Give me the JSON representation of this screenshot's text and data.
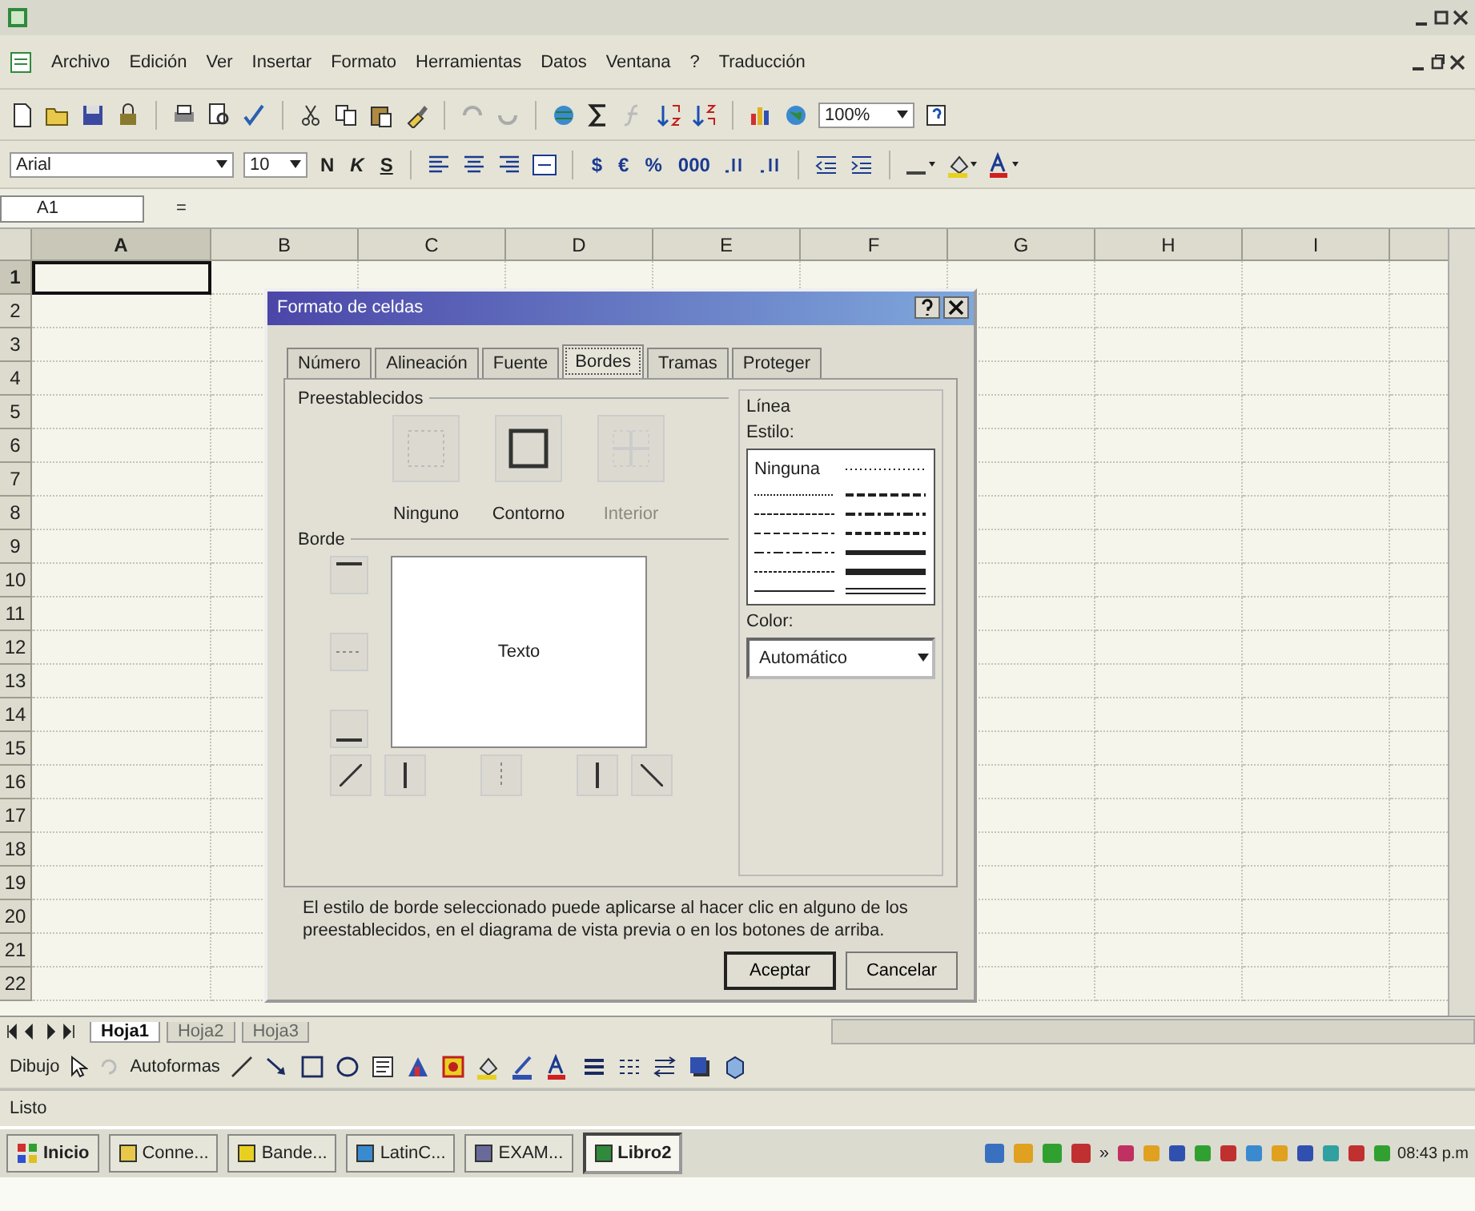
{
  "menu_bar": [
    "Archivo",
    "Edición",
    "Ver",
    "Insertar",
    "Formato",
    "Herramientas",
    "Datos",
    "Ventana",
    "?",
    "Traducción"
  ],
  "standard_toolbar": {
    "zoom": "100%"
  },
  "formatting_toolbar": {
    "font": "Arial",
    "size": "10",
    "style_buttons": [
      "N",
      "K",
      "S"
    ],
    "number_buttons": [
      "$",
      "€",
      "%",
      "000"
    ]
  },
  "formula_bar": {
    "name_box": "A1",
    "value": "="
  },
  "sheet": {
    "columns": [
      {
        "label": "A",
        "selected": true
      },
      {
        "label": "B",
        "selected": false
      },
      {
        "label": "C",
        "selected": false
      },
      {
        "label": "D",
        "selected": false
      },
      {
        "label": "E",
        "selected": false
      },
      {
        "label": "F",
        "selected": false
      },
      {
        "label": "G",
        "selected": false
      },
      {
        "label": "H",
        "selected": false
      },
      {
        "label": "I",
        "selected": false
      }
    ],
    "rows": [
      {
        "label": "1",
        "selected": true
      },
      {
        "label": "2",
        "selected": false
      },
      {
        "label": "3",
        "selected": false
      },
      {
        "label": "4",
        "selected": false
      },
      {
        "label": "5",
        "selected": false
      },
      {
        "label": "6",
        "selected": false
      },
      {
        "label": "7",
        "selected": false
      },
      {
        "label": "8",
        "selected": false
      },
      {
        "label": "9",
        "selected": false
      },
      {
        "label": "10",
        "selected": false
      },
      {
        "label": "11",
        "selected": false
      },
      {
        "label": "12",
        "selected": false
      },
      {
        "label": "13",
        "selected": false
      },
      {
        "label": "14",
        "selected": false
      },
      {
        "label": "15",
        "selected": false
      },
      {
        "label": "16",
        "selected": false
      },
      {
        "label": "17",
        "selected": false
      },
      {
        "label": "18",
        "selected": false
      },
      {
        "label": "19",
        "selected": false
      },
      {
        "label": "20",
        "selected": false
      },
      {
        "label": "21",
        "selected": false
      },
      {
        "label": "22",
        "selected": false
      }
    ]
  },
  "sheet_tabs": [
    {
      "label": "Hoja1",
      "selected": true
    },
    {
      "label": "Hoja2",
      "selected": false
    },
    {
      "label": "Hoja3",
      "selected": false
    }
  ],
  "dialog": {
    "title": "Formato de celdas",
    "tabs": [
      {
        "label": "Número",
        "selected": false
      },
      {
        "label": "Alineación",
        "selected": false
      },
      {
        "label": "Fuente",
        "selected": false
      },
      {
        "label": "Bordes",
        "selected": true
      },
      {
        "label": "Tramas",
        "selected": false
      },
      {
        "label": "Proteger",
        "selected": false
      }
    ],
    "presets_label": "Preestablecidos",
    "presets": [
      {
        "label": "Ninguno",
        "disabled": false
      },
      {
        "label": "Contorno",
        "disabled": false
      },
      {
        "label": "Interior",
        "disabled": true
      }
    ],
    "border_label": "Borde",
    "preview_text": "Texto",
    "line_label": "Línea",
    "style_label": "Estilo:",
    "none_style": "Ninguna",
    "color_label": "Color:",
    "color_value": "Automático",
    "hint": "El estilo de borde seleccionado puede aplicarse al hacer clic en alguno de los preestablecidos, en el diagrama de vista previa o en los botones de arriba.",
    "buttons": [
      "Aceptar",
      "Cancelar"
    ]
  },
  "drawing_toolbar": {
    "draw_menu": "Dibujo",
    "autoshapes_menu": "Autoformas"
  },
  "status_bar": {
    "text": "Listo"
  },
  "taskbar": {
    "start": "Inicio",
    "tasks": [
      {
        "label": "Conne...",
        "selected": false
      },
      {
        "label": "Bande...",
        "selected": false
      },
      {
        "label": "LatinC...",
        "selected": false
      },
      {
        "label": "EXAM...",
        "selected": false
      },
      {
        "label": "Libro2",
        "selected": true
      }
    ],
    "more": "»",
    "clock": "08:43 p.m"
  }
}
